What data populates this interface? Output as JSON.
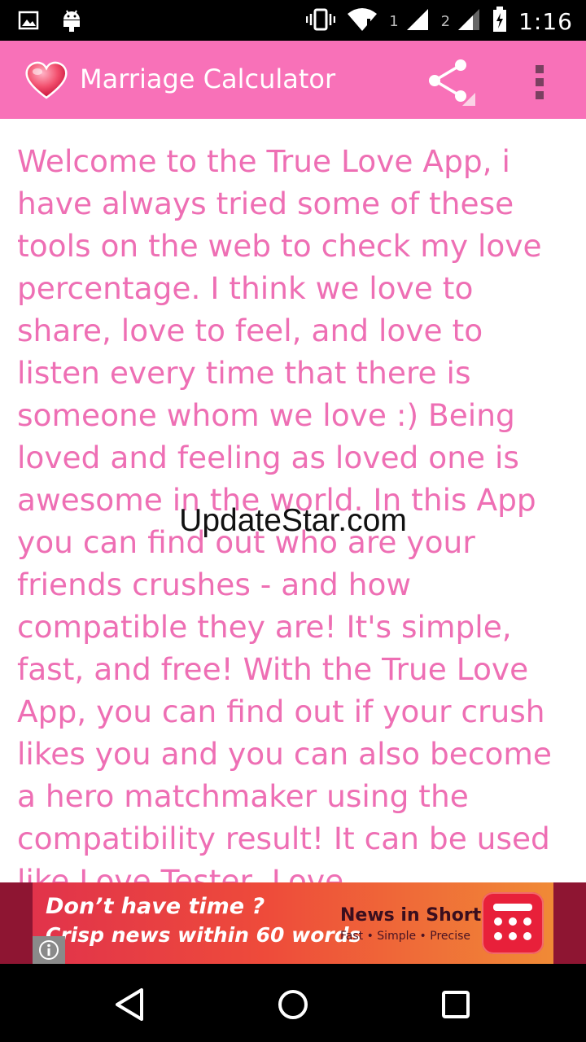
{
  "status_bar": {
    "time": "1:16",
    "sim1_label": "1",
    "sim2_label": "2"
  },
  "action_bar": {
    "title": "Marriage Calculator",
    "background_color": "#f871b8"
  },
  "content": {
    "text": "Welcome to the True Love App, i have always tried some of these tools on the web to check my love percentage. I think we love to share, love to feel, and love to listen every time that there is someone whom we love :) Being loved and feeling as loved one is awesome in the world. In this App you can find out who are your friends crushes - and how compatible they are! It's simple, fast, and free! With the True Love App, you can find out if your crush likes you and you can also become a hero matchmaker using the compatibility result!  It can be used like Love Tester, Love",
    "text_color": "#ee6fb4",
    "watermark": "UpdateStar.com"
  },
  "ad": {
    "headline": "Don’t have time ?",
    "subline": "Crisp news within 60 words",
    "brand": "News in Shorts",
    "tagline": "Fast • Simple • Precise"
  }
}
